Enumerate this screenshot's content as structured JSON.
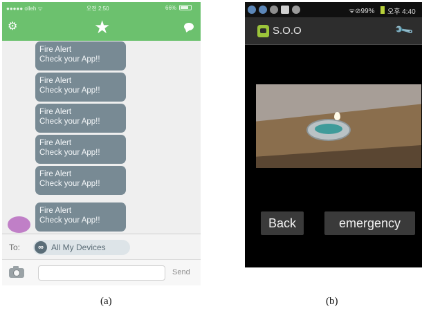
{
  "panel_a": {
    "status_bar": {
      "carrier": "●●●●● olleh ᯤ",
      "time": "오전 2:50",
      "battery": "66%"
    },
    "toolbar_icons": [
      "gear-icon",
      "star-icon",
      "chat-bubble-icon"
    ],
    "messages": [
      {
        "line1": "Fire Alert",
        "line2": "Check your App!!"
      },
      {
        "line1": "Fire Alert",
        "line2": "Check your App!!"
      },
      {
        "line1": "Fire Alert",
        "line2": "Check your App!!"
      },
      {
        "line1": "Fire Alert",
        "line2": "Check your App!!"
      },
      {
        "line1": "Fire Alert",
        "line2": "Check your App!!"
      },
      {
        "line1": "Fire Alert",
        "line2": "Check your App!!"
      }
    ],
    "to_label": "To:",
    "recipient_icon": "∞",
    "recipient": "All My Devices",
    "message_input": {
      "value": "",
      "placeholder": ""
    },
    "send_label": "Send",
    "colors": {
      "header": "#6cc16e",
      "bubble": "#788a94",
      "avatar": "#c07fc7"
    }
  },
  "panel_b": {
    "status_bar": {
      "left_icons": "● ● ● ▣ ◍",
      "right": "ᯤ⊘99%",
      "time": "오후 4:40"
    },
    "title": "S.O.O",
    "buttons": {
      "back": "Back",
      "emergency": "emergency"
    },
    "colors": {
      "title_bar": "#2d2d2d",
      "button": "#3a3a3a",
      "app_icon": "#9bc43a"
    }
  },
  "captions": {
    "a": "(a)",
    "b": "(b)"
  }
}
